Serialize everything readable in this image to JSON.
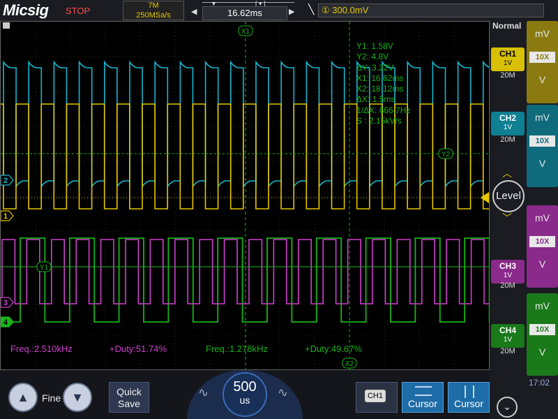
{
  "header": {
    "brand": "Micsig",
    "run_state": "STOP",
    "memory_depth": "7M",
    "sample_rate": "250MSa/s",
    "timebase_position": "16.62ms",
    "trigger": {
      "source": "①",
      "level": "300.0mV"
    }
  },
  "trigger_mode": "Normal",
  "channels": [
    {
      "name": "CH1",
      "scale": "1V",
      "bandwidth": "20M",
      "color": "#e6c800",
      "probe": "10X",
      "unit": "mV",
      "unit2": "V"
    },
    {
      "name": "CH2",
      "scale": "1V",
      "bandwidth": "20M",
      "color": "#19b7d0",
      "probe": "10X",
      "unit": "mV",
      "unit2": "V"
    },
    {
      "name": "CH3",
      "scale": "1V",
      "bandwidth": "20M",
      "color": "#d040d0",
      "probe": "10X",
      "unit": "mV",
      "unit2": "V"
    },
    {
      "name": "CH4",
      "scale": "1V",
      "bandwidth": "20M",
      "color": "#18b418",
      "probe": "10X",
      "unit": "mV",
      "unit2": "V"
    }
  ],
  "markers": {
    "ch1": "1",
    "ch2": "2",
    "ch3": "3",
    "ch4": "4"
  },
  "cursors": {
    "x1_label": "X1",
    "x2_label": "X2",
    "y1_label": "Y1",
    "y2_label": "Y2",
    "readout": [
      "Y1:  1.58V",
      "Y2:  4.8V",
      "ΔY:  3.22V",
      "X1:  16.62ms",
      "X2:  18.12ms",
      "ΔX:  1.5ms",
      "1/ΔX:  666.7Hz",
      "S :  2.15kV/s"
    ]
  },
  "measurements": [
    {
      "text": "Freq.:2.510kHz",
      "color": "#d040d0"
    },
    {
      "text": "+Duty:51.74%",
      "color": "#d040d0"
    },
    {
      "text": "Freq.:1.278kHz",
      "color": "#18b418"
    },
    {
      "text": "+Duty:49.67%",
      "color": "#18b418"
    }
  ],
  "level_label": "Level",
  "bottom": {
    "fine_label": "Fine",
    "quick_save_line1": "Quick",
    "quick_save_line2": "Save",
    "timebase_value": "500",
    "timebase_unit": "us",
    "ch1_tag": "CH1",
    "cursor_h_label": "Cursor",
    "cursor_v_label": "Cursor"
  },
  "clock": "17:02"
}
